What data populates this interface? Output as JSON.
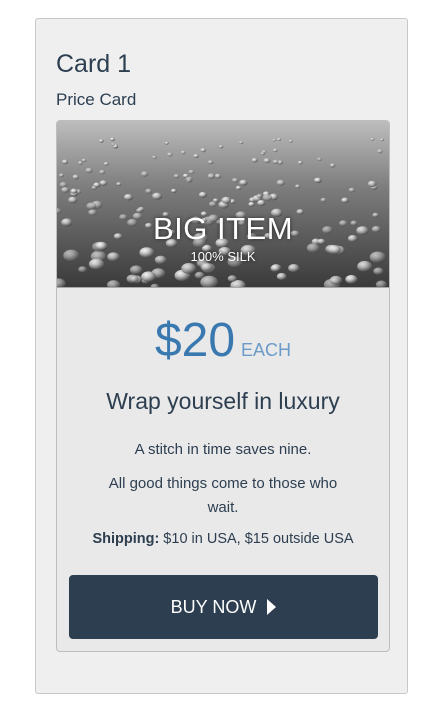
{
  "panel": {
    "title": "Card 1",
    "subtitle": "Price Card"
  },
  "card": {
    "hero": {
      "title": "BIG ITEM",
      "subtitle": "100% SILK",
      "image_description_icon": "water-droplets-image"
    },
    "price": {
      "amount": "$20",
      "unit": "EACH"
    },
    "tagline": "Wrap yourself in luxury",
    "descriptions": [
      "A stitch in time saves nine.",
      "All good things come to those who wait."
    ],
    "shipping": {
      "label": "Shipping:",
      "text": " $10 in USA, $15 outside USA"
    },
    "button": {
      "label": "BUY NOW",
      "icon": "caret-right-icon"
    }
  },
  "colors": {
    "accent": "#3a78b0",
    "accent_light": "#6a9bc9",
    "button_bg": "#2c3e50",
    "text": "#2c3e50",
    "panel_bg": "#efefef",
    "card_bg": "#e9e9e9"
  }
}
